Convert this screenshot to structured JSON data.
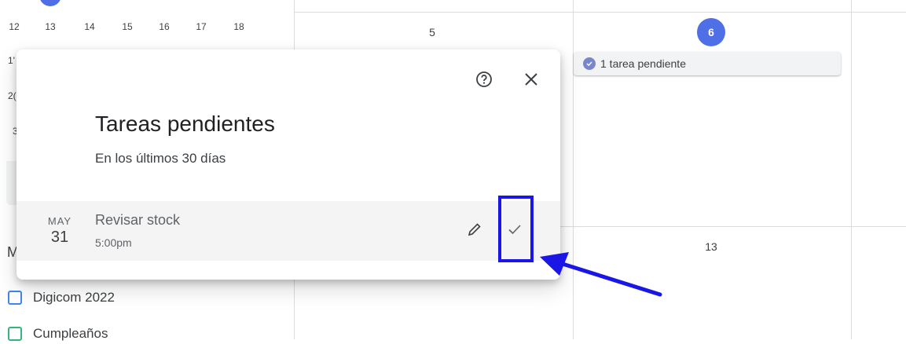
{
  "mini_calendar": {
    "week_row": [
      "12",
      "13",
      "14",
      "15",
      "16",
      "17",
      "18"
    ],
    "partial_rows": [
      "1'",
      "2(",
      "3"
    ]
  },
  "sidebar": {
    "section_initial": "M",
    "calendars": [
      {
        "label": "Digicom 2022",
        "color": "#4285f4"
      },
      {
        "label": "Cumpleaños",
        "color": "#33b679"
      }
    ]
  },
  "grid": {
    "day_5": "5",
    "day_6": "6",
    "day_13": "13",
    "today_color": "#4e6fe5",
    "task_chip": "1 tarea pendiente"
  },
  "dialog": {
    "title": "Tareas pendientes",
    "subtitle": "En los últimos 30 días",
    "help_icon": "help-circle-icon",
    "close_icon": "close-icon",
    "task": {
      "month": "MAY",
      "day": "31",
      "name": "Revisar stock",
      "time": "5:00pm",
      "edit_icon": "pencil-icon",
      "complete_icon": "check-icon"
    }
  },
  "annotation": {
    "highlight_color": "#1a17e6"
  }
}
